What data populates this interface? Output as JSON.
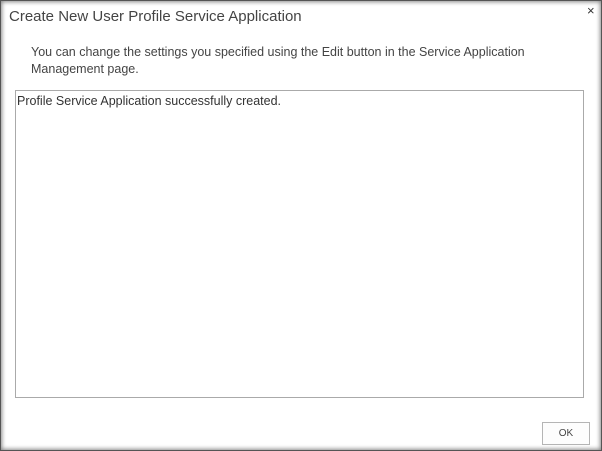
{
  "dialog": {
    "title": "Create New User Profile Service Application",
    "close_icon": "×",
    "message": "You can change the settings you specified using the Edit button in the Service Application Management page.",
    "output_text": "Profile Service Application successfully created.",
    "ok_label": "OK"
  }
}
